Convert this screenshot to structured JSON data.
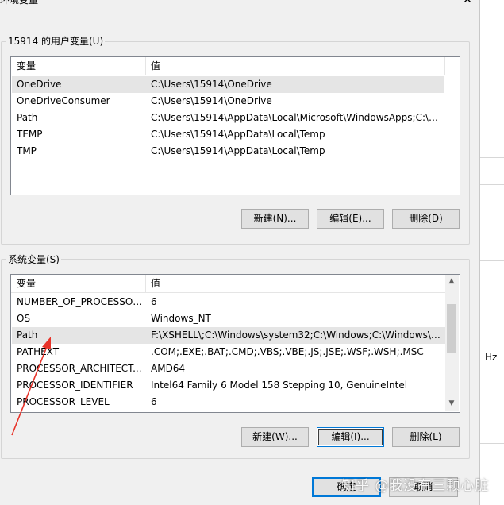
{
  "dialog": {
    "title": "环境变量",
    "close_glyph": "✕"
  },
  "user_vars": {
    "group_label": "15914 的用户变量(U)",
    "columns": [
      "变量",
      "值"
    ],
    "rows": [
      {
        "name": "OneDrive",
        "value": "C:\\Users\\15914\\OneDrive"
      },
      {
        "name": "OneDriveConsumer",
        "value": "C:\\Users\\15914\\OneDrive"
      },
      {
        "name": "Path",
        "value": "C:\\Users\\15914\\AppData\\Local\\Microsoft\\WindowsApps;C:\\U..."
      },
      {
        "name": "TEMP",
        "value": "C:\\Users\\15914\\AppData\\Local\\Temp"
      },
      {
        "name": "TMP",
        "value": "C:\\Users\\15914\\AppData\\Local\\Temp"
      }
    ],
    "buttons": {
      "new": "新建(N)...",
      "edit": "编辑(E)...",
      "delete": "删除(D)"
    }
  },
  "sys_vars": {
    "group_label": "系统变量(S)",
    "columns": [
      "变量",
      "值"
    ],
    "rows": [
      {
        "name": "NUMBER_OF_PROCESSORS",
        "value": "6"
      },
      {
        "name": "OS",
        "value": "Windows_NT"
      },
      {
        "name": "Path",
        "value": "F:\\XSHELL\\;C:\\Windows\\system32;C:\\Windows;C:\\Windows\\Sy..."
      },
      {
        "name": "PATHEXT",
        "value": ".COM;.EXE;.BAT;.CMD;.VBS;.VBE;.JS;.JSE;.WSF;.WSH;.MSC"
      },
      {
        "name": "PROCESSOR_ARCHITECT...",
        "value": "AMD64"
      },
      {
        "name": "PROCESSOR_IDENTIFIER",
        "value": "Intel64 Family 6 Model 158 Stepping 10, GenuineIntel"
      },
      {
        "name": "PROCESSOR_LEVEL",
        "value": "6"
      }
    ],
    "buttons": {
      "new": "新建(W)...",
      "edit": "编辑(I)...",
      "delete": "删除(L)"
    }
  },
  "footer": {
    "ok": "确定",
    "cancel": "取消"
  },
  "background_window": {
    "text": "Hz"
  },
  "watermark": "知乎 @我没有三颗心脏",
  "colors": {
    "annotation_arrow": "#e8332a",
    "selected_row": "#e5e5e5",
    "accent": "#0078d7"
  },
  "icons": {
    "scroll_up": "▲",
    "scroll_down": "▼"
  }
}
